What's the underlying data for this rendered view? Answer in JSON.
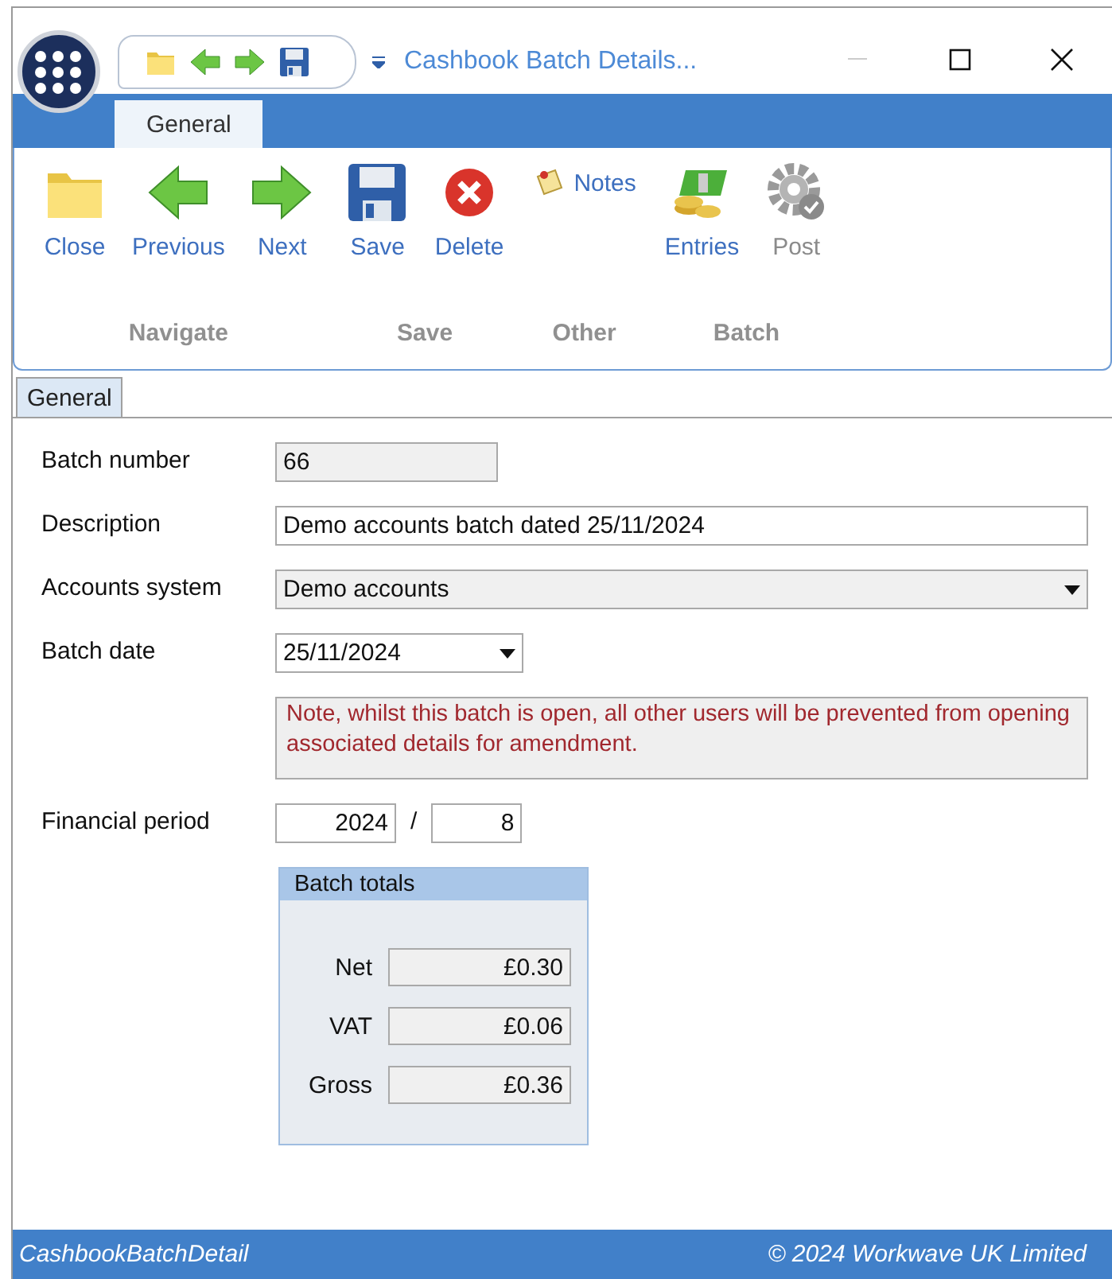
{
  "window": {
    "title": "Cashbook Batch Details..."
  },
  "ribbon_tabs": [
    {
      "label": "General",
      "selected": true
    }
  ],
  "ribbon_groups": [
    {
      "label": "Navigate",
      "buttons": [
        {
          "label": "Close",
          "kind": "large",
          "disabled": false
        },
        {
          "label": "Previous",
          "kind": "large",
          "disabled": false
        },
        {
          "label": "Next",
          "kind": "large",
          "disabled": false
        }
      ]
    },
    {
      "label": "Save",
      "buttons": [
        {
          "label": "Save",
          "kind": "large",
          "disabled": false
        },
        {
          "label": "Delete",
          "kind": "large",
          "disabled": false
        }
      ]
    },
    {
      "label": "Other",
      "buttons": [
        {
          "label": "Notes",
          "kind": "small",
          "disabled": false
        }
      ]
    },
    {
      "label": "Batch",
      "buttons": [
        {
          "label": "Entries",
          "kind": "large",
          "disabled": false
        },
        {
          "label": "Post",
          "kind": "large",
          "disabled": true
        }
      ]
    }
  ],
  "page_tabs": [
    {
      "label": "General",
      "selected": true
    }
  ],
  "fields": [
    {
      "kind": "readonly",
      "label": "Batch number",
      "value": "66"
    },
    {
      "kind": "text",
      "label": "Description",
      "value": "Demo accounts batch dated 25/11/2024"
    },
    {
      "kind": "dropdown",
      "label": "Accounts system",
      "value": "Demo accounts"
    },
    {
      "kind": "date",
      "label": "Batch date",
      "value": "25/11/2024"
    },
    {
      "kind": "note",
      "text": "Note, whilst this batch is open, all other users will be prevented from opening associated details for amendment."
    },
    {
      "kind": "period",
      "label": "Financial period",
      "year": "2024",
      "separator": "/",
      "period": "8"
    }
  ],
  "totals": {
    "title": "Batch totals",
    "rows": [
      {
        "label": "Net",
        "value": "£0.30"
      },
      {
        "label": "VAT",
        "value": "£0.06"
      },
      {
        "label": "Gross",
        "value": "£0.36"
      }
    ]
  },
  "status_bar": {
    "left": "CashbookBatchDetail",
    "right": "© 2024 Workwave UK Limited"
  }
}
